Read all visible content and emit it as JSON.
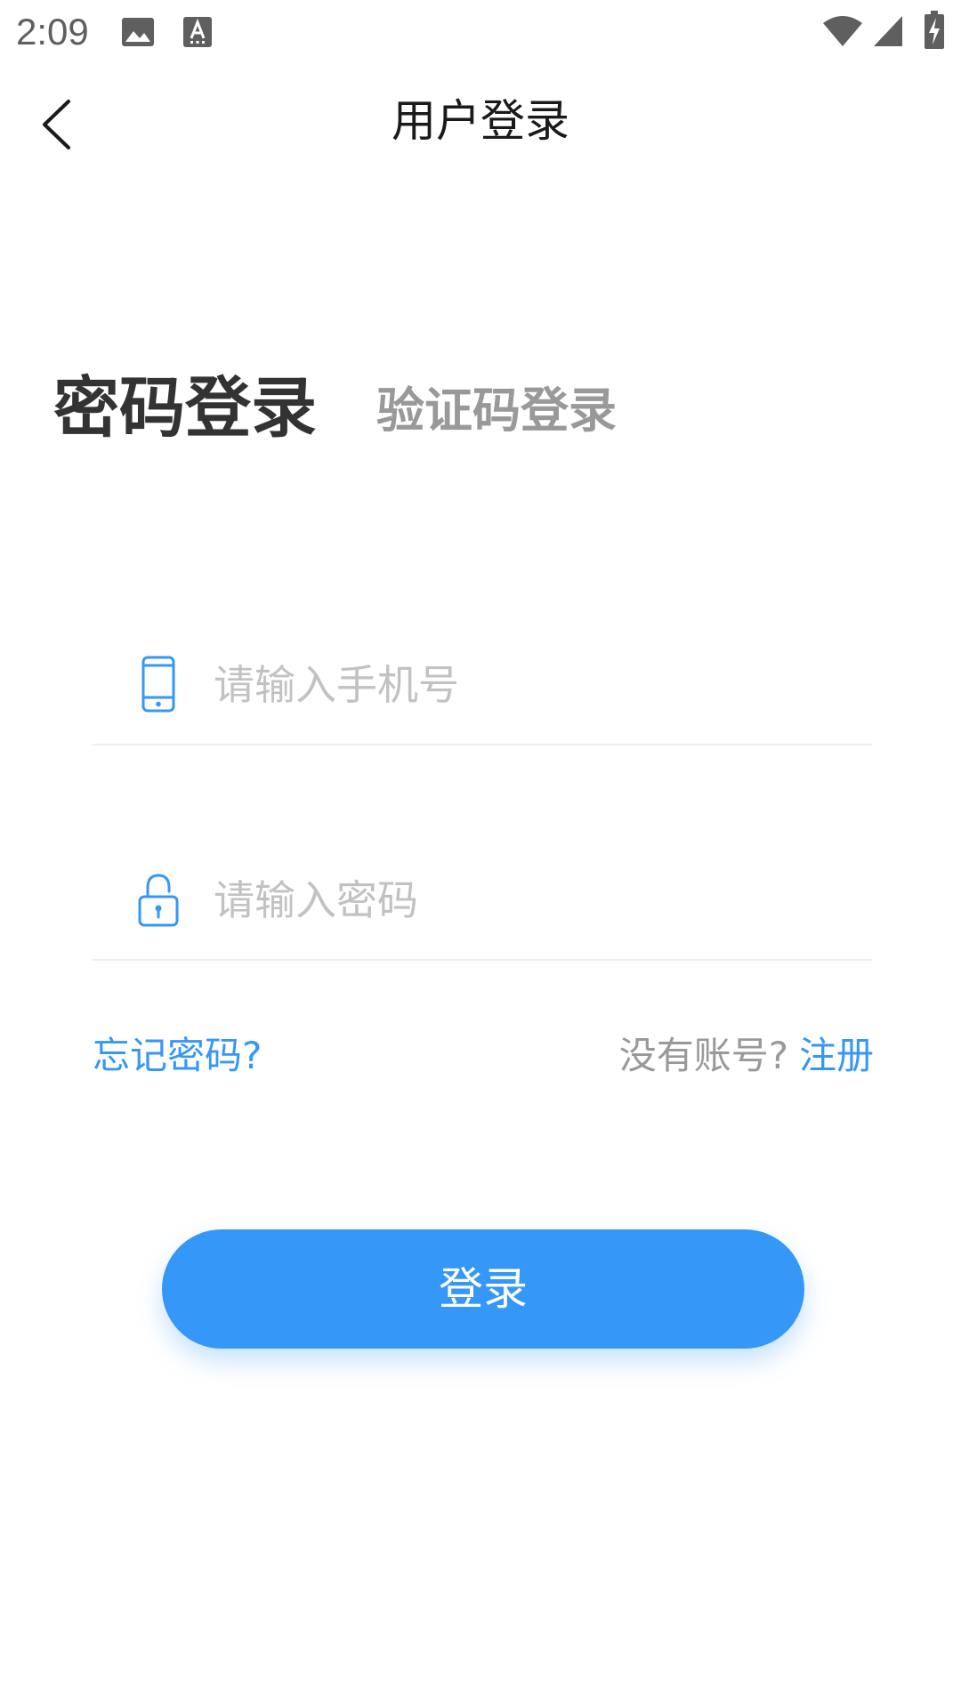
{
  "status_bar": {
    "time": "2:09",
    "icons": [
      "image-icon",
      "text-a-icon",
      "wifi-icon",
      "signal-icon",
      "battery-charging-icon"
    ]
  },
  "header": {
    "title": "用户登录",
    "back_icon": "chevron-left-icon"
  },
  "tabs": {
    "password_login": "密码登录",
    "code_login": "验证码登录",
    "active": "password_login"
  },
  "form": {
    "phone": {
      "placeholder": "请输入手机号",
      "value": "",
      "icon": "mobile-phone-icon"
    },
    "password": {
      "placeholder": "请输入密码",
      "value": "",
      "icon": "lock-icon"
    }
  },
  "links": {
    "forgot_password": "忘记密码?",
    "no_account": "没有账号?",
    "register": "注册"
  },
  "actions": {
    "login_label": "登录"
  },
  "colors": {
    "accent": "#3597f8",
    "title_text": "#1a1a1a",
    "active_tab": "#333333",
    "inactive_tab": "#999999",
    "placeholder": "#c2c2c2",
    "divider": "#eeeeee"
  }
}
